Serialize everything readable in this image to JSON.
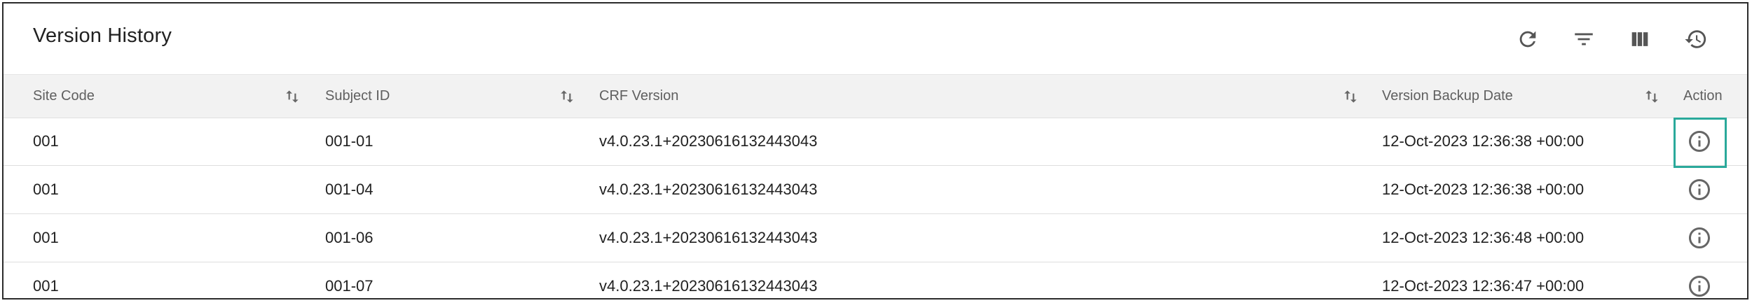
{
  "header": {
    "title": "Version History",
    "actions": [
      {
        "name": "refresh-icon"
      },
      {
        "name": "filter-icon"
      },
      {
        "name": "columns-icon"
      },
      {
        "name": "history-icon"
      }
    ]
  },
  "table": {
    "columns": [
      "Site Code",
      "Subject ID",
      "CRF Version",
      "Version Backup Date",
      "Action"
    ],
    "rows": [
      {
        "site_code": "001",
        "subject_id": "001-01",
        "crf_version": "v4.0.23.1+20230616132443043",
        "backup_date": "12-Oct-2023 12:36:38 +00:00"
      },
      {
        "site_code": "001",
        "subject_id": "001-04",
        "crf_version": "v4.0.23.1+20230616132443043",
        "backup_date": "12-Oct-2023 12:36:38 +00:00"
      },
      {
        "site_code": "001",
        "subject_id": "001-06",
        "crf_version": "v4.0.23.1+20230616132443043",
        "backup_date": "12-Oct-2023 12:36:48 +00:00"
      },
      {
        "site_code": "001",
        "subject_id": "001-07",
        "crf_version": "v4.0.23.1+20230616132443043",
        "backup_date": "12-Oct-2023 12:36:47 +00:00"
      }
    ]
  },
  "colors": {
    "highlight": "#2aa99b",
    "header_bg": "#f2f2f2"
  }
}
